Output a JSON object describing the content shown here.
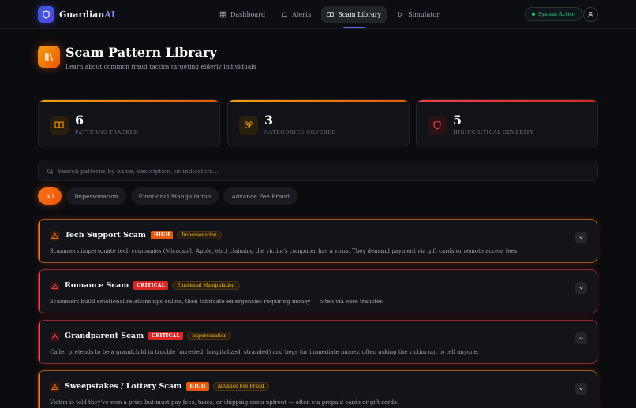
{
  "nav": {
    "brand_name": "Guardian",
    "brand_suffix": "AI",
    "tabs": [
      {
        "label": "Dashboard"
      },
      {
        "label": "Alerts"
      },
      {
        "label": "Scam Library"
      },
      {
        "label": "Simulator"
      }
    ],
    "status": "System Active"
  },
  "header": {
    "title": "Scam Pattern Library",
    "subtitle": "Learn about common fraud tactics targeting elderly individuals"
  },
  "stats": [
    {
      "value": "6",
      "label": "PATTERNS TRACKED"
    },
    {
      "value": "3",
      "label": "CATEGORIES COVERED"
    },
    {
      "value": "5",
      "label": "HIGH/CRITICAL SEVERITY"
    }
  ],
  "search": {
    "placeholder": "Search patterns by name, description, or indicators...",
    "value": ""
  },
  "filters": [
    "All",
    "Impersonation",
    "Emotional Manipulation",
    "Advance Fee Fraud"
  ],
  "patterns": [
    {
      "name": "Tech Support Scam",
      "severity": "HIGH",
      "category": "Impersonation",
      "description": "Scammers impersonate tech companies (Microsoft, Apple, etc.) claiming the victim's computer has a virus. They demand payment via gift cards or remote access fees."
    },
    {
      "name": "Romance Scam",
      "severity": "CRITICAL",
      "category": "Emotional Manipulation",
      "description": "Scammers build emotional relationships online, then fabricate emergencies requiring money — often via wire transfer."
    },
    {
      "name": "Grandparent Scam",
      "severity": "CRITICAL",
      "category": "Impersonation",
      "description": "Caller pretends to be a grandchild in trouble (arrested, hospitalized, stranded) and begs for immediate money, often asking the victim not to tell anyone."
    },
    {
      "name": "Sweepstakes / Lottery Scam",
      "severity": "HIGH",
      "category": "Advance Fee Fraud",
      "description": "Victim is told they've won a prize but must pay fees, taxes, or shipping costs upfront — often via prepaid cards or gift cards."
    }
  ],
  "colors": {
    "accent": "#f97316",
    "brand": "#6366f1",
    "critical": "#dc2626",
    "high": "#ea580c",
    "success": "#22c55e"
  }
}
